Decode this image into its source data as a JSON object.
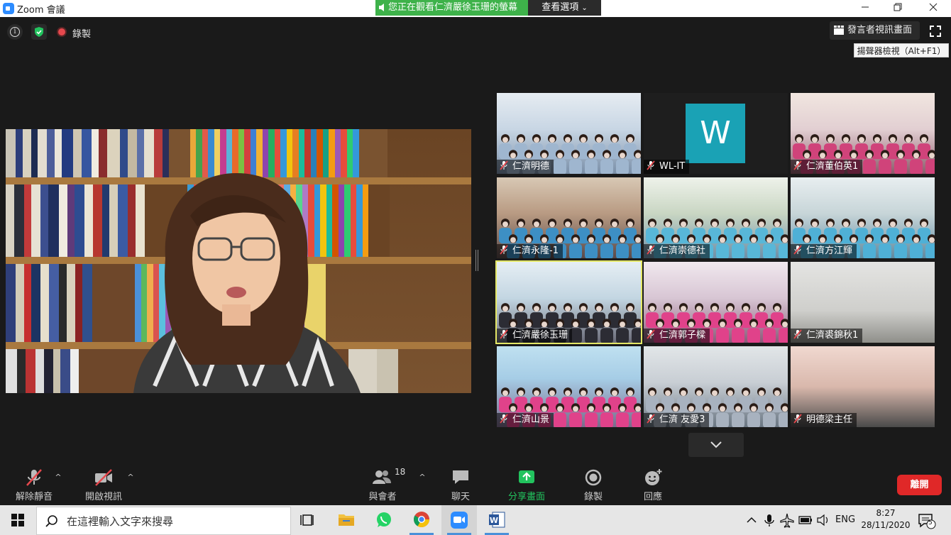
{
  "window": {
    "title": "Zoom 會議"
  },
  "banner": {
    "viewing_text": "您正在觀看仁濟嚴徐玉珊的螢幕",
    "view_options_label": "查看選項"
  },
  "topbar": {
    "recording_label": "錄製",
    "speaker_view_label": "發言者視訊畫面",
    "tooltip_text": "揚聲器檢視（Alt+F1）"
  },
  "gallery": {
    "tiles": [
      {
        "name": "仁濟明德"
      },
      {
        "name": "WL-IT",
        "avatar_letter": "W"
      },
      {
        "name": "仁濟董伯英1"
      },
      {
        "name": "仁濟永隆-1"
      },
      {
        "name": "仁濟崇德社"
      },
      {
        "name": "仁濟方江輝"
      },
      {
        "name": "仁濟嚴徐玉珊",
        "active": true
      },
      {
        "name": "仁濟郭子樑"
      },
      {
        "name": "仁濟裘錦秋1"
      },
      {
        "name": "仁濟山景"
      },
      {
        "name": "仁濟 友愛3"
      },
      {
        "name": "明德梁主任"
      }
    ]
  },
  "toolbar": {
    "unmute_label": "解除靜音",
    "start_video_label": "開啟視訊",
    "participants_label": "與會者",
    "participants_count": "18",
    "chat_label": "聊天",
    "share_label": "分享畫面",
    "record_label": "錄製",
    "reactions_label": "回應",
    "leave_label": "離開"
  },
  "taskbar": {
    "search_placeholder": "在這裡輸入文字來搜尋",
    "language": "ENG",
    "time": "8:27",
    "date": "28/11/2020",
    "notification_count": "5"
  },
  "colors": {
    "share_green": "#3eb24a",
    "active_speaker_outline": "#e4e765",
    "leave_red": "#e02828",
    "avatar_teal": "#1aa2b5",
    "mute_red": "#e5484d"
  }
}
